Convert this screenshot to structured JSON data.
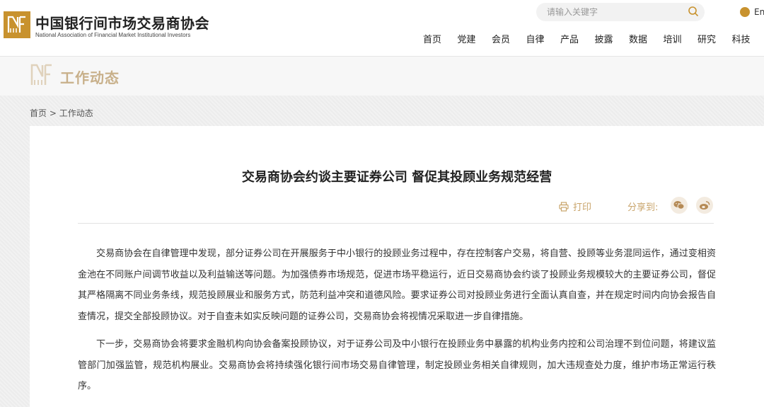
{
  "header": {
    "site_name_cn": "中国银行间市场交易商协会",
    "site_name_en": "National Association of Financial Market Institutional Investors",
    "search_placeholder": "请输入关键字",
    "lang_label": "En",
    "nav": [
      "首页",
      "党建",
      "会员",
      "自律",
      "产品",
      "披露",
      "数据",
      "培训",
      "研究",
      "科技"
    ]
  },
  "section": {
    "title": "工作动态"
  },
  "breadcrumb": {
    "home": "首页",
    "separator": " > ",
    "current": "工作动态"
  },
  "article": {
    "title": "交易商协会约谈主要证券公司 督促其投顾业务规范经营",
    "print_label": "打印",
    "share_label": "分享到:",
    "paragraphs": [
      "交易商协会在自律管理中发现，部分证券公司在开展服务于中小银行的投顾业务过程中，存在控制客户交易，将自营、投顾等业务混同运作，通过变相资金池在不同账户间调节收益以及利益输送等问题。为加强债券市场规范，促进市场平稳运行，近日交易商协会约谈了投顾业务规模较大的主要证券公司，督促其严格隔离不同业务条线，规范投顾展业和服务方式，防范利益冲突和道德风险。要求证券公司对投顾业务进行全面认真自查，并在规定时间内向协会报告自查情况，提交全部投顾协议。对于自查未如实反映问题的证券公司，交易商协会将视情况采取进一步自律措施。",
      "下一步，交易商协会将要求金融机构向协会备案投顾协议，对于证券公司及中小银行在投顾业务中暴露的机构业务内控和公司治理不到位问题，将建议监管部门加强监管，规范机构展业。交易商协会将持续强化银行间市场交易自律管理，制定投顾业务相关自律规则，加大违规查处力度，维护市场正常运行秩序。"
    ]
  },
  "colors": {
    "brand_gold": "#c8922e",
    "accent_tan": "#c9a56c",
    "section_title": "#c8b08a"
  },
  "icons": {
    "search": "search-icon",
    "globe": "globe-icon",
    "print": "print-icon",
    "wechat": "wechat-icon",
    "weibo": "weibo-icon"
  }
}
